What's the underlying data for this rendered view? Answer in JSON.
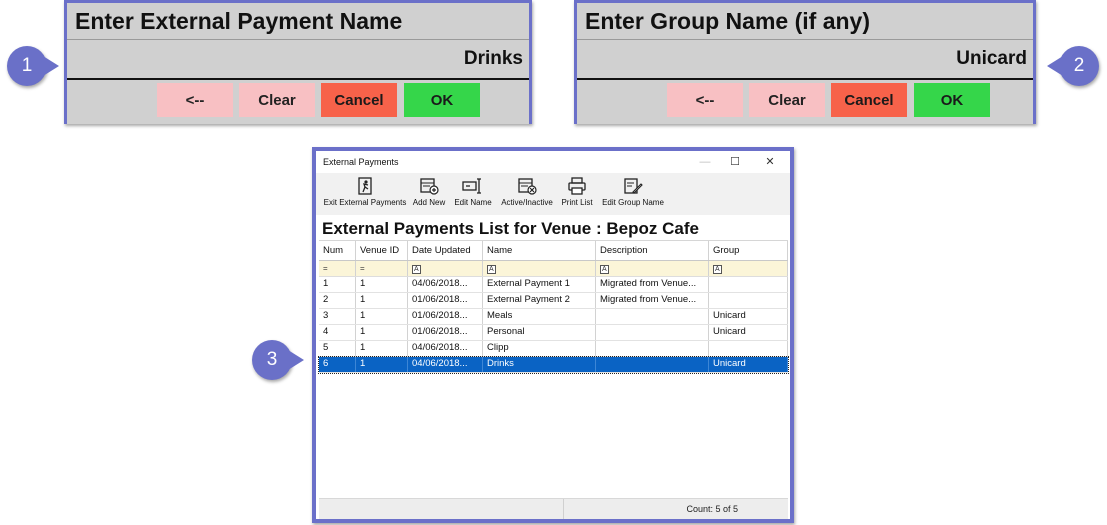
{
  "dialog1": {
    "prompt": "Enter External Payment Name",
    "value": "Drinks",
    "buttons": {
      "back": "<--",
      "clear": "Clear",
      "cancel": "Cancel",
      "ok": "OK"
    }
  },
  "dialog2": {
    "prompt": "Enter Group Name (if any)",
    "value": "Unicard",
    "buttons": {
      "back": "<--",
      "clear": "Clear",
      "cancel": "Cancel",
      "ok": "OK"
    }
  },
  "badges": {
    "one": "1",
    "two": "2",
    "three": "3"
  },
  "window": {
    "title": "External Payments",
    "controls": {
      "minimize": "—",
      "maximize": "☐",
      "close": "✕"
    },
    "toolbar": {
      "exit": "Exit External Payments",
      "add_new": "Add New",
      "edit_name": "Edit Name",
      "active_inactive": "Active/Inactive",
      "print_list": "Print List",
      "edit_group_name": "Edit Group Name"
    },
    "heading": "External Payments List for Venue : Bepoz Cafe",
    "columns": [
      "Num",
      "Venue ID",
      "Date Updated",
      "Name",
      "Description",
      "Group"
    ],
    "filter_icons": [
      "=",
      "=",
      "A",
      "A",
      "A",
      "A"
    ],
    "rows": [
      [
        "1",
        "1",
        "04/06/2018...",
        "External Payment 1",
        "Migrated from Venue...",
        ""
      ],
      [
        "2",
        "1",
        "01/06/2018...",
        "External Payment 2",
        "Migrated from Venue...",
        ""
      ],
      [
        "3",
        "1",
        "01/06/2018...",
        "Meals",
        "",
        "Unicard"
      ],
      [
        "4",
        "1",
        "01/06/2018...",
        "Personal",
        "",
        "Unicard"
      ],
      [
        "5",
        "1",
        "04/06/2018...",
        "Clipp",
        "",
        ""
      ],
      [
        "6",
        "1",
        "04/06/2018...",
        "Drinks",
        "",
        "Unicard"
      ]
    ],
    "selected_row": 6,
    "status": {
      "count": "Count: 5 of 5"
    }
  },
  "colors": {
    "accent": "#6b70c9",
    "selection": "#0a63c4",
    "cancel": "#f7624a",
    "ok": "#35d64a",
    "soft_button": "#f8c0c3",
    "filter_row": "#fbf5d8"
  }
}
